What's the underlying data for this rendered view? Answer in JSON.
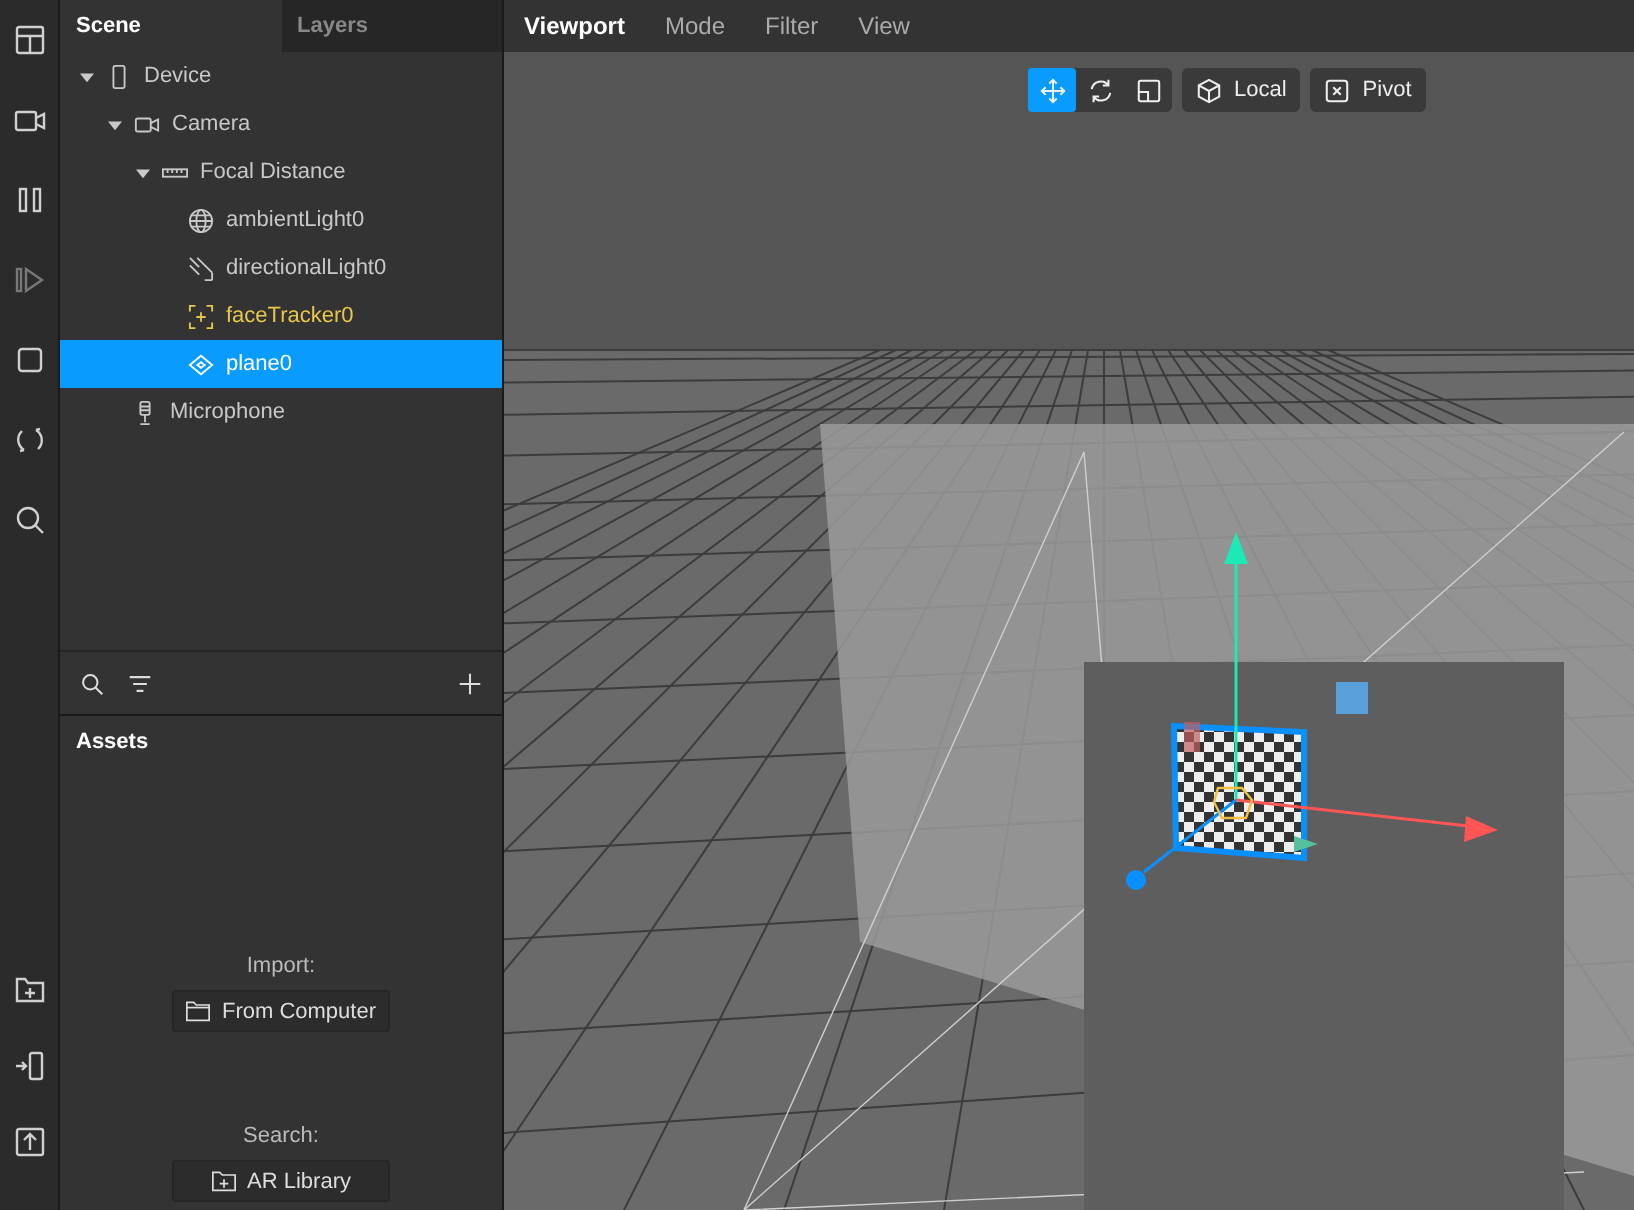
{
  "scene_panel": {
    "tabs": [
      {
        "label": "Scene",
        "selected": true
      },
      {
        "label": "Layers",
        "selected": false
      }
    ],
    "tree": [
      {
        "label": "Device",
        "kind": "device",
        "expanded": true,
        "selected": false,
        "children": [
          {
            "label": "Camera",
            "kind": "camera",
            "expanded": true,
            "selected": false,
            "children": [
              {
                "label": "Focal Distance",
                "kind": "ruler",
                "expanded": true,
                "selected": false,
                "children": [
                  {
                    "label": "ambientLight0",
                    "kind": "globe",
                    "selected": false
                  },
                  {
                    "label": "directionalLight0",
                    "kind": "light",
                    "selected": false
                  },
                  {
                    "label": "faceTracker0",
                    "kind": "tracker",
                    "selected": false
                  },
                  {
                    "label": "plane0",
                    "kind": "plane",
                    "selected": true
                  }
                ]
              }
            ]
          },
          {
            "label": "Microphone",
            "kind": "mic",
            "selected": false
          }
        ]
      }
    ]
  },
  "assets_panel": {
    "title": "Assets",
    "import_label": "Import:",
    "import_button": "From Computer",
    "search_label": "Search:",
    "search_button": "AR Library"
  },
  "viewport": {
    "menu": [
      {
        "label": "Viewport",
        "selected": true
      },
      {
        "label": "Mode",
        "selected": false
      },
      {
        "label": "Filter",
        "selected": false
      },
      {
        "label": "View",
        "selected": false
      }
    ],
    "tools": [
      {
        "kind": "move",
        "selected": true
      },
      {
        "kind": "rotate",
        "selected": false
      },
      {
        "kind": "scale",
        "selected": false
      }
    ],
    "space_button": "Local",
    "pivot_button": "Pivot"
  }
}
